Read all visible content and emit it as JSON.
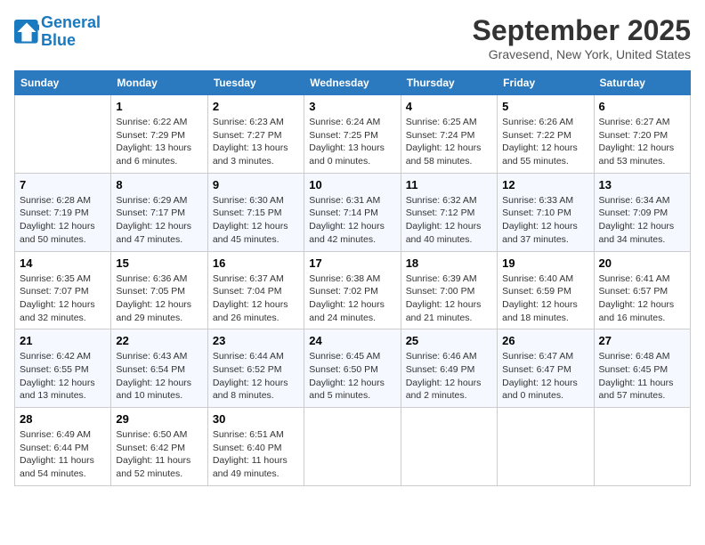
{
  "header": {
    "logo_line1": "General",
    "logo_line2": "Blue",
    "month": "September 2025",
    "location": "Gravesend, New York, United States"
  },
  "weekdays": [
    "Sunday",
    "Monday",
    "Tuesday",
    "Wednesday",
    "Thursday",
    "Friday",
    "Saturday"
  ],
  "weeks": [
    [
      {
        "day": "",
        "sunrise": "",
        "sunset": "",
        "daylight": ""
      },
      {
        "day": "1",
        "sunrise": "Sunrise: 6:22 AM",
        "sunset": "Sunset: 7:29 PM",
        "daylight": "Daylight: 13 hours and 6 minutes."
      },
      {
        "day": "2",
        "sunrise": "Sunrise: 6:23 AM",
        "sunset": "Sunset: 7:27 PM",
        "daylight": "Daylight: 13 hours and 3 minutes."
      },
      {
        "day": "3",
        "sunrise": "Sunrise: 6:24 AM",
        "sunset": "Sunset: 7:25 PM",
        "daylight": "Daylight: 13 hours and 0 minutes."
      },
      {
        "day": "4",
        "sunrise": "Sunrise: 6:25 AM",
        "sunset": "Sunset: 7:24 PM",
        "daylight": "Daylight: 12 hours and 58 minutes."
      },
      {
        "day": "5",
        "sunrise": "Sunrise: 6:26 AM",
        "sunset": "Sunset: 7:22 PM",
        "daylight": "Daylight: 12 hours and 55 minutes."
      },
      {
        "day": "6",
        "sunrise": "Sunrise: 6:27 AM",
        "sunset": "Sunset: 7:20 PM",
        "daylight": "Daylight: 12 hours and 53 minutes."
      }
    ],
    [
      {
        "day": "7",
        "sunrise": "Sunrise: 6:28 AM",
        "sunset": "Sunset: 7:19 PM",
        "daylight": "Daylight: 12 hours and 50 minutes."
      },
      {
        "day": "8",
        "sunrise": "Sunrise: 6:29 AM",
        "sunset": "Sunset: 7:17 PM",
        "daylight": "Daylight: 12 hours and 47 minutes."
      },
      {
        "day": "9",
        "sunrise": "Sunrise: 6:30 AM",
        "sunset": "Sunset: 7:15 PM",
        "daylight": "Daylight: 12 hours and 45 minutes."
      },
      {
        "day": "10",
        "sunrise": "Sunrise: 6:31 AM",
        "sunset": "Sunset: 7:14 PM",
        "daylight": "Daylight: 12 hours and 42 minutes."
      },
      {
        "day": "11",
        "sunrise": "Sunrise: 6:32 AM",
        "sunset": "Sunset: 7:12 PM",
        "daylight": "Daylight: 12 hours and 40 minutes."
      },
      {
        "day": "12",
        "sunrise": "Sunrise: 6:33 AM",
        "sunset": "Sunset: 7:10 PM",
        "daylight": "Daylight: 12 hours and 37 minutes."
      },
      {
        "day": "13",
        "sunrise": "Sunrise: 6:34 AM",
        "sunset": "Sunset: 7:09 PM",
        "daylight": "Daylight: 12 hours and 34 minutes."
      }
    ],
    [
      {
        "day": "14",
        "sunrise": "Sunrise: 6:35 AM",
        "sunset": "Sunset: 7:07 PM",
        "daylight": "Daylight: 12 hours and 32 minutes."
      },
      {
        "day": "15",
        "sunrise": "Sunrise: 6:36 AM",
        "sunset": "Sunset: 7:05 PM",
        "daylight": "Daylight: 12 hours and 29 minutes."
      },
      {
        "day": "16",
        "sunrise": "Sunrise: 6:37 AM",
        "sunset": "Sunset: 7:04 PM",
        "daylight": "Daylight: 12 hours and 26 minutes."
      },
      {
        "day": "17",
        "sunrise": "Sunrise: 6:38 AM",
        "sunset": "Sunset: 7:02 PM",
        "daylight": "Daylight: 12 hours and 24 minutes."
      },
      {
        "day": "18",
        "sunrise": "Sunrise: 6:39 AM",
        "sunset": "Sunset: 7:00 PM",
        "daylight": "Daylight: 12 hours and 21 minutes."
      },
      {
        "day": "19",
        "sunrise": "Sunrise: 6:40 AM",
        "sunset": "Sunset: 6:59 PM",
        "daylight": "Daylight: 12 hours and 18 minutes."
      },
      {
        "day": "20",
        "sunrise": "Sunrise: 6:41 AM",
        "sunset": "Sunset: 6:57 PM",
        "daylight": "Daylight: 12 hours and 16 minutes."
      }
    ],
    [
      {
        "day": "21",
        "sunrise": "Sunrise: 6:42 AM",
        "sunset": "Sunset: 6:55 PM",
        "daylight": "Daylight: 12 hours and 13 minutes."
      },
      {
        "day": "22",
        "sunrise": "Sunrise: 6:43 AM",
        "sunset": "Sunset: 6:54 PM",
        "daylight": "Daylight: 12 hours and 10 minutes."
      },
      {
        "day": "23",
        "sunrise": "Sunrise: 6:44 AM",
        "sunset": "Sunset: 6:52 PM",
        "daylight": "Daylight: 12 hours and 8 minutes."
      },
      {
        "day": "24",
        "sunrise": "Sunrise: 6:45 AM",
        "sunset": "Sunset: 6:50 PM",
        "daylight": "Daylight: 12 hours and 5 minutes."
      },
      {
        "day": "25",
        "sunrise": "Sunrise: 6:46 AM",
        "sunset": "Sunset: 6:49 PM",
        "daylight": "Daylight: 12 hours and 2 minutes."
      },
      {
        "day": "26",
        "sunrise": "Sunrise: 6:47 AM",
        "sunset": "Sunset: 6:47 PM",
        "daylight": "Daylight: 12 hours and 0 minutes."
      },
      {
        "day": "27",
        "sunrise": "Sunrise: 6:48 AM",
        "sunset": "Sunset: 6:45 PM",
        "daylight": "Daylight: 11 hours and 57 minutes."
      }
    ],
    [
      {
        "day": "28",
        "sunrise": "Sunrise: 6:49 AM",
        "sunset": "Sunset: 6:44 PM",
        "daylight": "Daylight: 11 hours and 54 minutes."
      },
      {
        "day": "29",
        "sunrise": "Sunrise: 6:50 AM",
        "sunset": "Sunset: 6:42 PM",
        "daylight": "Daylight: 11 hours and 52 minutes."
      },
      {
        "day": "30",
        "sunrise": "Sunrise: 6:51 AM",
        "sunset": "Sunset: 6:40 PM",
        "daylight": "Daylight: 11 hours and 49 minutes."
      },
      {
        "day": "",
        "sunrise": "",
        "sunset": "",
        "daylight": ""
      },
      {
        "day": "",
        "sunrise": "",
        "sunset": "",
        "daylight": ""
      },
      {
        "day": "",
        "sunrise": "",
        "sunset": "",
        "daylight": ""
      },
      {
        "day": "",
        "sunrise": "",
        "sunset": "",
        "daylight": ""
      }
    ]
  ]
}
